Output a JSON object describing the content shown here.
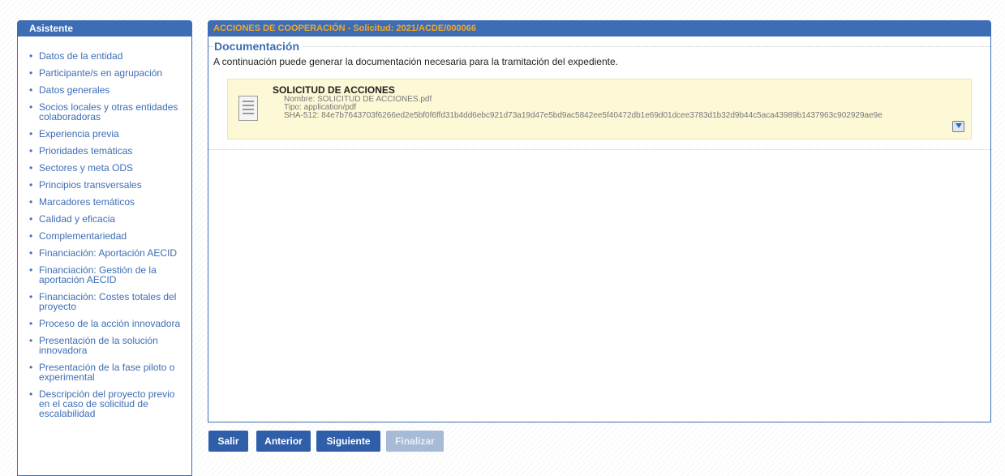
{
  "sidebar": {
    "title": "Asistente",
    "items": [
      {
        "label": "Datos de la entidad"
      },
      {
        "label": "Participante/s en agrupación"
      },
      {
        "label": "Datos generales"
      },
      {
        "label": "Socios locales y otras entidades colaboradoras"
      },
      {
        "label": "Experiencia previa"
      },
      {
        "label": "Prioridades temáticas"
      },
      {
        "label": "Sectores y meta ODS"
      },
      {
        "label": "Principios transversales"
      },
      {
        "label": "Marcadores temáticos"
      },
      {
        "label": "Calidad y eficacia"
      },
      {
        "label": "Complementariedad"
      },
      {
        "label": "Financiación: Aportación AECID"
      },
      {
        "label": "Financiación: Gestión de la aportación AECID"
      },
      {
        "label": "Financiación: Costes totales del proyecto"
      },
      {
        "label": "Proceso de la acción innovadora"
      },
      {
        "label": "Presentación de la solución innovadora"
      },
      {
        "label": "Presentación de la fase piloto o experimental"
      },
      {
        "label": "Descripción del proyecto previo en el caso de solicitud de escalabilidad"
      }
    ]
  },
  "main": {
    "header": "ACCIONES DE COOPERACIÓN - Solicitud: 2021/ACDE/000066",
    "section_title": "Documentación",
    "intro": "A continuación puede generar la documentación necesaria para la tramitación del expediente.",
    "document": {
      "title": "SOLICITUD DE ACCIONES",
      "name": "Nombre: SOLICITUD DE ACCIONES.pdf",
      "type": "Tipo: application/pdf",
      "hash": "SHA-512: 84e7b7643703f6266ed2e5bf0f6ffd31b4dd6ebc921d73a19d47e5bd9ac5842ee5f40472db1e69d01dcee3783d1b32d9b44c5aca43989b1437963c902929ae9e",
      "icon": "pdf-document-icon",
      "download_icon": "download-icon"
    }
  },
  "buttons": {
    "exit": "Salir",
    "previous": "Anterior",
    "next": "Siguiente",
    "finish": "Finalizar",
    "finish_enabled": false
  },
  "colors": {
    "primary": "#3d6eb5",
    "header_text": "#f6a623",
    "card_bg": "#fdf8d6"
  }
}
